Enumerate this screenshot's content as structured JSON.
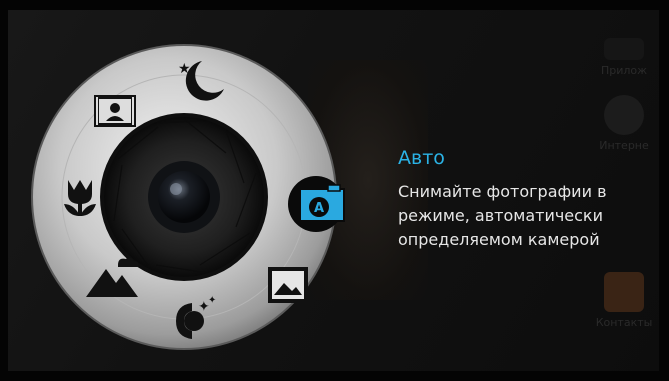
{
  "mode": {
    "title": "Авто",
    "description_lines": [
      "Снимайте фотографии в",
      "режиме, автоматически",
      "определяемом камерой"
    ]
  },
  "background_apps": [
    {
      "label": "Прилож",
      "color": "#2a2a2a"
    },
    {
      "label": "Интерне",
      "color": "#2a2a2a"
    },
    {
      "label": "Контакты",
      "color": "#3a2415"
    }
  ],
  "dial_modes": [
    {
      "name": "night-mode",
      "selected": false
    },
    {
      "name": "panorama-mode",
      "selected": false
    },
    {
      "name": "auto-mode",
      "selected": true
    },
    {
      "name": "landscape-mode",
      "selected": false
    },
    {
      "name": "portrait-mode",
      "selected": false
    },
    {
      "name": "macro-mode",
      "selected": false
    },
    {
      "name": "hdr-mode",
      "selected": false
    },
    {
      "name": "scenery-mode",
      "selected": false
    }
  ],
  "colors": {
    "accent": "#2bb3e6",
    "selected_bg": "#2aa9e0",
    "text": "#e6e6e6"
  }
}
